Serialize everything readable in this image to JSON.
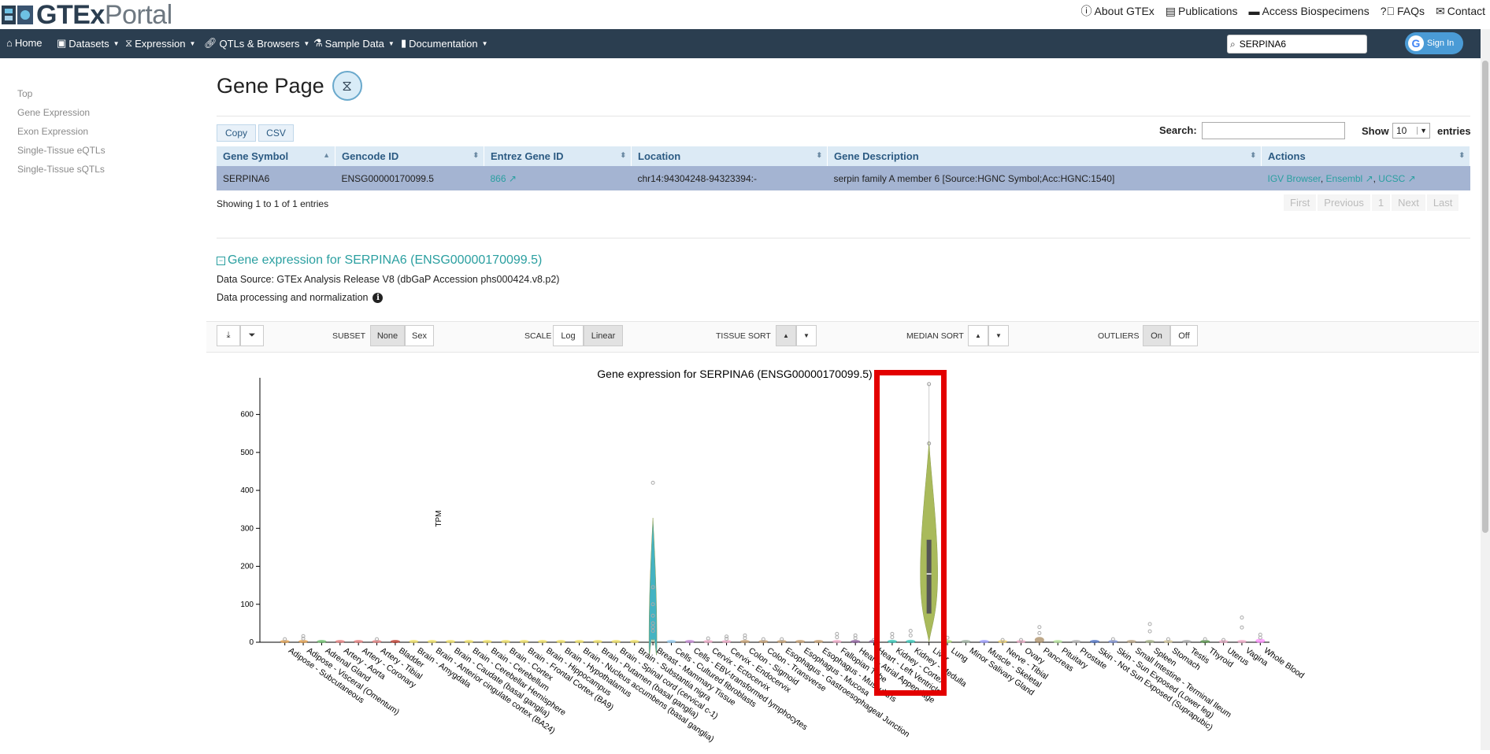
{
  "header": {
    "logo_gtex": "GTEx",
    "logo_portal": "Portal",
    "links": [
      {
        "icon": "info-icon",
        "label": "About GTEx"
      },
      {
        "icon": "newspaper-icon",
        "label": "Publications"
      },
      {
        "icon": "inbox-icon",
        "label": "Access Biospecimens"
      },
      {
        "icon": "question-icon",
        "label": "FAQs"
      },
      {
        "icon": "envelope-icon",
        "label": "Contact"
      }
    ]
  },
  "nav": {
    "items": [
      "Home",
      "Datasets",
      "Expression",
      "QTLs & Browsers",
      "Sample Data",
      "Documentation"
    ],
    "search_value": "SERPINA6",
    "signin_label": "Sign In"
  },
  "sidenav": [
    "Top",
    "Gene Expression",
    "Exon Expression",
    "Single-Tissue eQTLs",
    "Single-Tissue sQTLs"
  ],
  "page_title": "Gene Page",
  "table_controls": {
    "copy": "Copy",
    "csv": "CSV",
    "search_label": "Search:",
    "show_label": "Show",
    "show_value": "10",
    "entries_label": "entries"
  },
  "gene_table": {
    "headers": [
      "Gene Symbol",
      "Gencode ID",
      "Entrez Gene ID",
      "Location",
      "Gene Description",
      "Actions"
    ],
    "row": {
      "symbol": "SERPINA6",
      "gencode": "ENSG00000170099.5",
      "entrez": "866",
      "location": "chr14:94304248-94323394:-",
      "description": "serpin family A member 6 [Source:HGNC Symbol;Acc:HGNC:1540]",
      "actions": [
        "IGV Browser",
        "Ensembl",
        "UCSC"
      ]
    },
    "showing": "Showing 1 to 1 of 1 entries",
    "pager": [
      "First",
      "Previous",
      "1",
      "Next",
      "Last"
    ]
  },
  "expression": {
    "heading": "Gene expression for SERPINA6 (ENSG00000170099.5)",
    "source": "Data Source: GTEx Analysis Release V8 (dbGaP Accession phs000424.v8.p2)",
    "processing": "Data processing and normalization"
  },
  "toolbar": {
    "subset_label": "SUBSET",
    "subset_options": [
      "None",
      "Sex"
    ],
    "scale_label": "SCALE",
    "scale_options": [
      "Log",
      "Linear"
    ],
    "tissue_sort_label": "TISSUE SORT",
    "median_sort_label": "MEDIAN SORT",
    "outliers_label": "OUTLIERS",
    "outlier_options": [
      "On",
      "Off"
    ]
  },
  "chart_data": {
    "type": "violin",
    "title": "Gene expression for SERPINA6 (ENSG00000170099.5)",
    "ylabel": "TPM",
    "ylim": [
      0,
      680
    ],
    "yticks": [
      0,
      100,
      200,
      300,
      400,
      500,
      600
    ],
    "highlight_color": "#e30000",
    "categories": [
      "Adipose - Subcutaneous",
      "Adipose - Visceral (Omentum)",
      "Adrenal Gland",
      "Artery - Aorta",
      "Artery - Coronary",
      "Artery - Tibial",
      "Bladder",
      "Brain - Amygdala",
      "Brain - Anterior cingulate cortex (BA24)",
      "Brain - Caudate (basal ganglia)",
      "Brain - Cerebellar Hemisphere",
      "Brain - Cerebellum",
      "Brain - Cortex",
      "Brain - Frontal Cortex (BA9)",
      "Brain - Hippocampus",
      "Brain - Hypothalamus",
      "Brain - Nucleus accumbens (basal ganglia)",
      "Brain - Putamen (basal ganglia)",
      "Brain - Spinal cord (cervical c-1)",
      "Brain - Substantia nigra",
      "Breast - Mammary Tissue",
      "Cells - Cultured fibroblasts",
      "Cells - EBV-transformed lymphocytes",
      "Cervix - Ectocervix",
      "Cervix - Endocervix",
      "Colon - Sigmoid",
      "Colon - Transverse",
      "Esophagus - Gastroesophageal Junction",
      "Esophagus - Mucosa",
      "Esophagus - Muscularis",
      "Fallopian Tube",
      "Heart - Atrial Appendage",
      "Heart - Left Ventricle",
      "Kidney - Cortex",
      "Kidney - Medulla",
      "Liver",
      "Lung",
      "Minor Salivary Gland",
      "Muscle - Skeletal",
      "Nerve - Tibial",
      "Ovary",
      "Pancreas",
      "Pituitary",
      "Prostate",
      "Skin - Not Sun Exposed (Suprapubic)",
      "Skin - Sun Exposed (Lower leg)",
      "Small Intestine - Terminal Ileum",
      "Spleen",
      "Stomach",
      "Testis",
      "Thyroid",
      "Uterus",
      "Vagina",
      "Whole Blood"
    ],
    "medians": [
      2,
      3,
      2,
      2,
      2,
      2,
      1,
      0.5,
      0.5,
      0.5,
      0.5,
      0.5,
      0.5,
      0.5,
      0.5,
      0.5,
      0.5,
      0.5,
      0.5,
      0.5,
      5,
      0.5,
      0.5,
      1,
      1,
      2,
      2,
      2,
      1,
      2,
      1,
      1,
      1,
      3,
      3,
      180,
      2,
      1,
      1,
      1,
      1,
      8,
      1,
      1,
      1,
      1,
      2,
      1,
      1,
      1,
      2,
      1,
      2,
      5
    ],
    "maxima": [
      8,
      16,
      6,
      6,
      6,
      8,
      3,
      1,
      1,
      1,
      1,
      1,
      1,
      1,
      1,
      1,
      1,
      1,
      1,
      1,
      420,
      3,
      3,
      10,
      15,
      18,
      8,
      8,
      4,
      6,
      22,
      18,
      6,
      22,
      30,
      680,
      12,
      4,
      4,
      6,
      6,
      40,
      4,
      4,
      4,
      8,
      6,
      48,
      8,
      4,
      8,
      6,
      65,
      20
    ],
    "colors": [
      "#e6a04b",
      "#e6a04b",
      "#6bbf6b",
      "#e87d7d",
      "#e87d7d",
      "#e87d7d",
      "#c0392b",
      "#f0e060",
      "#f0e060",
      "#f0e060",
      "#f0e060",
      "#f0e060",
      "#f0e060",
      "#f0e060",
      "#f0e060",
      "#f0e060",
      "#f0e060",
      "#f0e060",
      "#f0e060",
      "#f0e060",
      "#44b3c2",
      "#8fc8ee",
      "#c183d3",
      "#f2a9c8",
      "#f2a9c8",
      "#c49c6c",
      "#c49c6c",
      "#c49c6c",
      "#c49c6c",
      "#c49c6c",
      "#f2a9c8",
      "#8b5a9b",
      "#8b5a9b",
      "#2ec4b6",
      "#2ec4b6",
      "#a9ba5b",
      "#a9d873",
      "#9db0a0",
      "#9999ff",
      "#f2d36b",
      "#f2a9c8",
      "#a88b62",
      "#b5e59b",
      "#b0b0b0",
      "#4b6fc4",
      "#7b8fd6",
      "#b6a080",
      "#a2af84",
      "#d5c89a",
      "#a6a6a6",
      "#4f9040",
      "#f2a9c8",
      "#f2a9c8",
      "#ff88ff"
    ]
  }
}
